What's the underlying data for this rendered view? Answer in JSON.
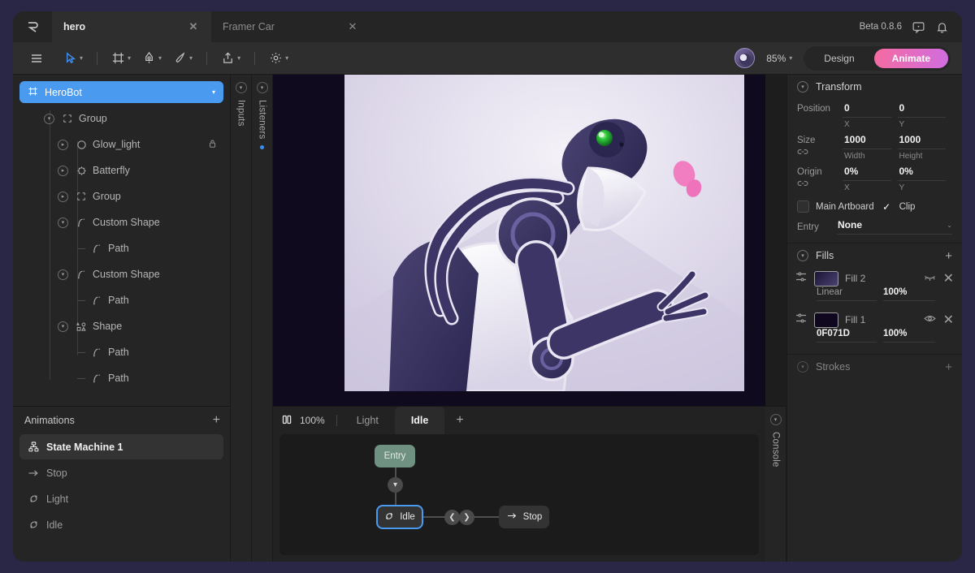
{
  "window": {
    "outer_background": "#2a2746",
    "app_background": "#1d1d1d"
  },
  "tabbar": {
    "logo_icon": "rive-logo-icon",
    "tabs": [
      {
        "label": "hero",
        "active": true,
        "close_icon": "close-icon"
      },
      {
        "label": "Framer Car",
        "active": false,
        "close_icon": "close-icon"
      }
    ],
    "version": "Beta 0.8.6",
    "feedback_icon": "comment-icon",
    "notification_icon": "bell-icon"
  },
  "toolbar": {
    "menu_icon": "hamburger-menu-icon",
    "tools": [
      {
        "name": "select-tool",
        "icon": "cursor-icon",
        "accent": true,
        "caret": "▾"
      },
      {
        "name": "artboard-tool",
        "icon": "frame-icon",
        "caret": "▾"
      },
      {
        "name": "pen-tool",
        "icon": "pen-icon",
        "caret": "▾"
      },
      {
        "name": "brush-tool",
        "icon": "brush-icon",
        "caret": "▾"
      },
      {
        "name": "export-tool",
        "icon": "export-icon",
        "caret": "▾"
      },
      {
        "name": "settings-tool",
        "icon": "gear-icon",
        "caret": "▾"
      }
    ],
    "zoom_level": "85%",
    "zoom_caret": "▾",
    "modes": [
      {
        "label": "Design",
        "active": false
      },
      {
        "label": "Animate",
        "active": true
      }
    ],
    "accent_color": "#3e8ef0",
    "animate_gradient_start": "#f56ba0",
    "animate_gradient_end": "#d06de0"
  },
  "layers": {
    "root": {
      "label": "HeroBot",
      "icon": "artboard-icon",
      "caret": "▾",
      "selected_color": "#4a9bf0"
    },
    "items": [
      {
        "label": "Group",
        "depth": 0,
        "icon": "group-icon",
        "disc": "▾",
        "lock": ""
      },
      {
        "label": "Glow_light",
        "depth": 1,
        "icon": "ellipse-icon",
        "disc": "▸",
        "lock": "lock-icon"
      },
      {
        "label": "Batterfly",
        "depth": 1,
        "icon": "vector-icon",
        "disc": "▸",
        "lock": ""
      },
      {
        "label": "Group",
        "depth": 1,
        "icon": "group-icon",
        "disc": "▸",
        "lock": ""
      },
      {
        "label": "Custom Shape",
        "depth": 1,
        "icon": "path-icon",
        "disc": "▾",
        "lock": ""
      },
      {
        "label": "Path",
        "depth": 2,
        "icon": "path-icon",
        "disc": "",
        "lock": ""
      },
      {
        "label": "Custom Shape",
        "depth": 1,
        "icon": "path-icon",
        "disc": "▾",
        "lock": ""
      },
      {
        "label": "Path",
        "depth": 2,
        "icon": "path-icon",
        "disc": "",
        "lock": ""
      },
      {
        "label": "Shape",
        "depth": 1,
        "icon": "shapes-icon",
        "disc": "▾",
        "lock": ""
      },
      {
        "label": "Path",
        "depth": 2,
        "icon": "path-icon",
        "disc": "",
        "lock": ""
      },
      {
        "label": "Path",
        "depth": 2,
        "icon": "path-icon",
        "disc": "",
        "lock": ""
      }
    ]
  },
  "animations": {
    "title": "Animations",
    "add_icon": "plus-icon",
    "items": [
      {
        "label": "State Machine 1",
        "icon": "state-machine-icon",
        "active": true
      },
      {
        "label": "Stop",
        "icon": "arrow-right-icon",
        "active": false
      },
      {
        "label": "Light",
        "icon": "loop-icon",
        "active": false
      },
      {
        "label": "Idle",
        "icon": "loop-icon",
        "active": false
      }
    ]
  },
  "rails": [
    {
      "label": "Inputs",
      "caret": "▾",
      "dot": false
    },
    {
      "label": "Listeners",
      "caret": "▾",
      "dot": true,
      "dot_color": "#3e8ef0"
    },
    {
      "label": "Console",
      "caret": "▾",
      "dot": false
    }
  ],
  "timeline": {
    "play_icon": "pause-icon",
    "speed": "100%",
    "tabs": [
      {
        "label": "Light",
        "active": false
      },
      {
        "label": "Idle",
        "active": true
      }
    ],
    "add_icon": "plus-icon",
    "graph": {
      "nodes": [
        {
          "label": "Entry",
          "type": "entry",
          "icon": "",
          "selected": false,
          "color": "#6f9182"
        },
        {
          "label": "Idle",
          "type": "state",
          "icon": "loop-icon",
          "selected": true,
          "color": "#333333"
        },
        {
          "label": "Stop",
          "type": "state",
          "icon": "arrow-right-icon",
          "selected": false,
          "color": "#333333"
        }
      ],
      "transition_prev_icon": "chevron-left-icon",
      "transition_next_icon": "chevron-right-icon",
      "entry_arrow_icon": "chevron-down-icon",
      "selection_color": "#4a9bf0"
    }
  },
  "inspector": {
    "transform": {
      "title": "Transform",
      "collapse_caret": "▾",
      "rows": [
        {
          "label": "Position",
          "sub_icon": "",
          "x_value": "0",
          "x_unit": "X",
          "y_value": "0",
          "y_unit": "Y"
        },
        {
          "label": "Size",
          "sub_icon": "link-icon",
          "x_value": "1000",
          "x_unit": "Width",
          "y_value": "1000",
          "y_unit": "Height"
        },
        {
          "label": "Origin",
          "sub_icon": "link-icon",
          "x_value": "0%",
          "x_unit": "X",
          "y_value": "0%",
          "y_unit": "Y"
        }
      ],
      "main_artboard": {
        "label": "Main Artboard",
        "checked": false
      },
      "clip": {
        "label": "Clip",
        "checked": true,
        "check_icon": "check-icon"
      },
      "entry": {
        "label": "Entry",
        "value": "None",
        "caret": "⌄"
      }
    },
    "fills": {
      "title": "Fills",
      "add_icon": "plus-icon",
      "items": [
        {
          "name": "Fill 2",
          "swatch_type": "linear-gradient",
          "swatch_from": "#1d1438",
          "swatch_to": "#4a4270",
          "value": "Linear",
          "value_muted": true,
          "opacity": "100%",
          "visibility_icon": "eye-closed-icon",
          "visible": false,
          "remove_icon": "close-icon",
          "options_icon": "sliders-icon"
        },
        {
          "name": "Fill 1",
          "swatch_type": "solid",
          "swatch_from": "#0F071D",
          "swatch_to": "#0F071D",
          "value": "0F071D",
          "value_muted": false,
          "opacity": "100%",
          "visibility_icon": "eye-open-icon",
          "visible": true,
          "remove_icon": "close-icon",
          "options_icon": "sliders-icon"
        }
      ]
    },
    "strokes": {
      "title": "Strokes",
      "add_icon": "plus-icon",
      "collapse_caret": "▾"
    }
  },
  "canvas": {
    "background": "#0f0a1e",
    "artboard_name": "HeroBot",
    "illustration": "robot-reaching-for-pink-butterfly",
    "robot_body_color": "#3a3560",
    "robot_highlight_color": "#f4f2f8",
    "eye_glow_color": "#3fd34a",
    "butterfly_color": "#f07ec0"
  }
}
